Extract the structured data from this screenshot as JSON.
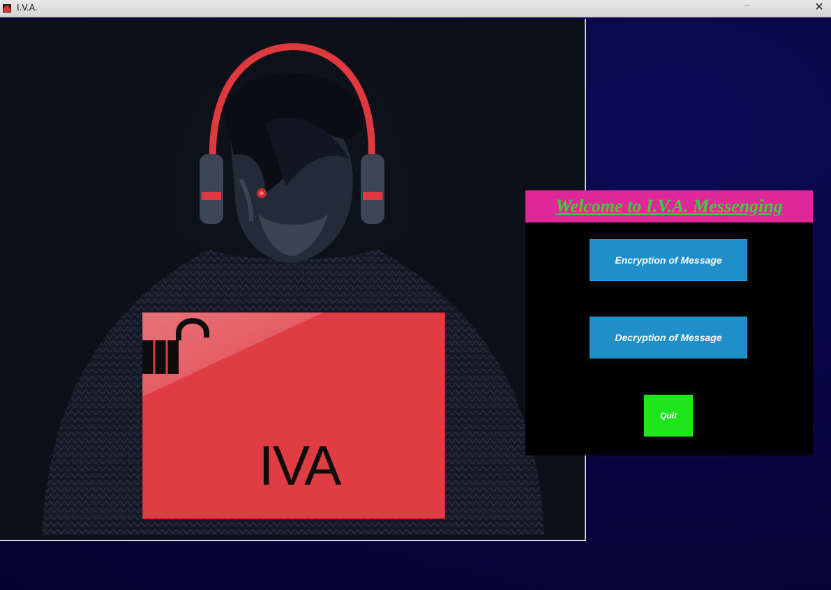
{
  "window": {
    "title": "I.V.A.",
    "minimize_glyph": "–",
    "close_glyph": "✕"
  },
  "artwork": {
    "logo_text": "IVA",
    "icons": [
      "hooded-figure-with-headphones",
      "open-padlock-icon"
    ],
    "colors": {
      "laptop_red": "#df3c44",
      "headphone_red": "#e0383f",
      "background": "#0c1019"
    }
  },
  "menu": {
    "welcome": "Welcome to I.V.A. Messenging",
    "encrypt_label": "Encryption of Message",
    "decrypt_label": "Decryption of Message",
    "quit_label": "Quit",
    "colors": {
      "banner": "#e0279a",
      "welcome_text": "#37d13b",
      "buttons": "#1f8fca",
      "quit": "#1ee61a"
    }
  }
}
